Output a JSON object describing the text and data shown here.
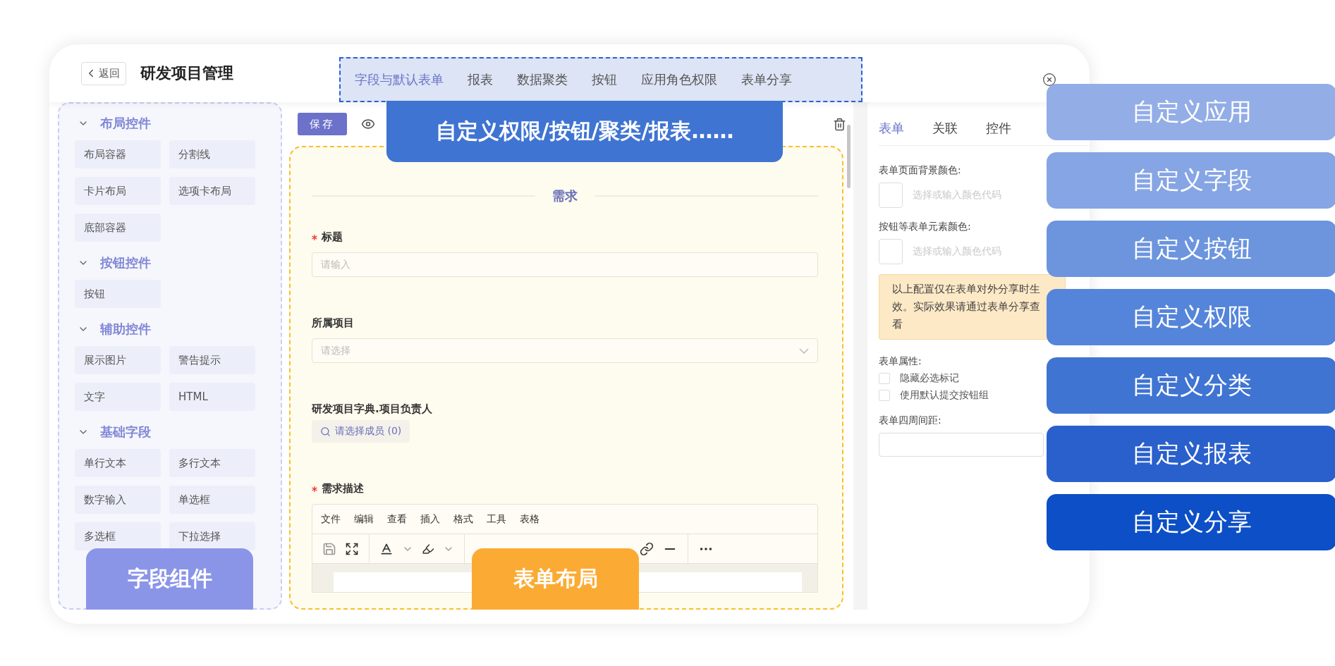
{
  "header": {
    "back": "返回",
    "title": "研发项目管理"
  },
  "top_tabs": [
    {
      "label": "字段与默认表单",
      "selected": true
    },
    {
      "label": "报表",
      "selected": false
    },
    {
      "label": "数据聚类",
      "selected": false
    },
    {
      "label": "按钮",
      "selected": false
    },
    {
      "label": "应用角色权限",
      "selected": false
    },
    {
      "label": "表单分享",
      "selected": false
    }
  ],
  "palette": [
    {
      "title": "布局控件",
      "expanded": true,
      "items": [
        "布局容器",
        "分割线",
        "卡片布局",
        "选项卡布局",
        "底部容器"
      ]
    },
    {
      "title": "按钮控件",
      "expanded": true,
      "items": [
        "按钮"
      ]
    },
    {
      "title": "辅助控件",
      "expanded": true,
      "items": [
        "展示图片",
        "警告提示",
        "文字",
        "HTML"
      ]
    },
    {
      "title": "基础字段",
      "expanded": true,
      "items": [
        "单行文本",
        "多行文本",
        "数字输入",
        "单选框",
        "多选框",
        "下拉选择"
      ]
    }
  ],
  "designer": {
    "save": "保存",
    "section_title": "需求",
    "fields": [
      {
        "kind": "input",
        "label": "标题",
        "required": true,
        "placeholder": "请输入"
      },
      {
        "kind": "select",
        "label": "所属项目",
        "required": false,
        "placeholder": "请选择"
      },
      {
        "kind": "member",
        "label": "研发项目字典.项目负责人",
        "required": false,
        "button": "请选择成员 (0)"
      },
      {
        "kind": "editor",
        "label": "需求描述",
        "required": true,
        "menu": [
          "文件",
          "编辑",
          "查看",
          "插入",
          "格式",
          "工具",
          "表格"
        ]
      }
    ]
  },
  "properties": {
    "tabs": [
      {
        "label": "表单",
        "selected": true
      },
      {
        "label": "关联",
        "selected": false
      },
      {
        "label": "控件",
        "selected": false
      }
    ],
    "colors": [
      {
        "label": "表单页面背景颜色:",
        "placeholder": "选择或输入颜色代码"
      },
      {
        "label": "按钮等表单元素颜色:",
        "placeholder": "选择或输入颜色代码"
      }
    ],
    "notice": "以上配置仅在表单对外分享时生效。实际效果请通过表单分享查看",
    "attributes_label": "表单属性:",
    "options": [
      {
        "label": "隐藏必选标记",
        "checked": false
      },
      {
        "label": "使用默认提交按钮组",
        "checked": false
      }
    ],
    "padding_label": "表单四周间距:"
  },
  "callouts": {
    "top": "自定义权限/按钮/聚类/报表……",
    "left": "字段组件",
    "center": "表单布局",
    "features": [
      {
        "label": "自定义应用",
        "color": "#93ade6"
      },
      {
        "label": "自定义字段",
        "color": "#86a5e4"
      },
      {
        "label": "自定义按钮",
        "color": "#6c95de"
      },
      {
        "label": "自定义权限",
        "color": "#5585da"
      },
      {
        "label": "自定义分类",
        "color": "#3f74d2"
      },
      {
        "label": "自定义报表",
        "color": "#2a60cc"
      },
      {
        "label": "自定义分享",
        "color": "#0d4fc6"
      }
    ]
  }
}
